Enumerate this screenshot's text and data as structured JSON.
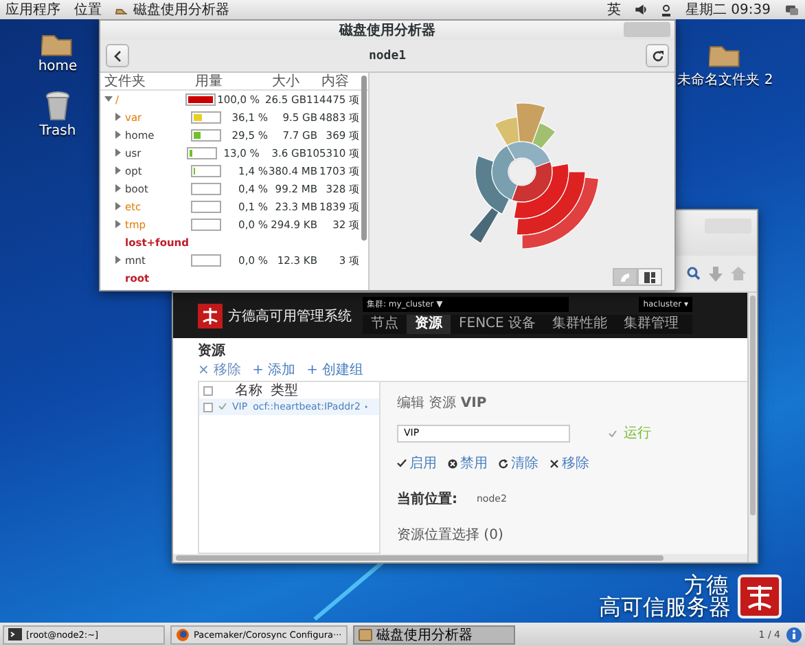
{
  "top_panel": {
    "menus": [
      "应用程序",
      "位置"
    ],
    "active_app": "磁盘使用分析器",
    "input_method": "英",
    "clock": "星期二 09:39"
  },
  "desktop_icons": [
    {
      "label": "home",
      "kind": "folder"
    },
    {
      "label": "Trash",
      "kind": "trash"
    },
    {
      "label": "未命名文件夹 2",
      "kind": "folder"
    }
  ],
  "wallpaper_text": [
    "方德",
    "高可信服务器"
  ],
  "disk_window": {
    "title": "磁盘使用分析器",
    "location": "node1",
    "columns": [
      "文件夹",
      "用量",
      "大小",
      "内容"
    ],
    "tree": [
      {
        "name": "/",
        "color": "#e07b00",
        "expanded": true,
        "level": 1,
        "percent": "100,0 %",
        "size": "26.5 GB",
        "count": "114475 项",
        "children": [
          {
            "name": "var",
            "color": "#e07b00",
            "expanded": false,
            "level": 0.361,
            "percent": "36,1 %",
            "size": "9.5 GB",
            "count": "4883 项"
          },
          {
            "name": "home",
            "color": "#3c3c3c",
            "expanded": false,
            "level": 0.295,
            "percent": "29,5 %",
            "size": "7.7 GB",
            "count": "369 项"
          },
          {
            "name": "usr",
            "color": "#3c3c3c",
            "expanded": false,
            "level": 0.13,
            "percent": "13,0 %",
            "size": "3.6 GB",
            "count": "105310 项"
          },
          {
            "name": "opt",
            "color": "#3c3c3c",
            "expanded": false,
            "level": 0.014,
            "percent": "1,4 %",
            "size": "380.4 MB",
            "count": "1703 项"
          },
          {
            "name": "boot",
            "color": "#3c3c3c",
            "expanded": false,
            "level": 0.004,
            "percent": "0,4 %",
            "size": "99.2 MB",
            "count": "328 项"
          },
          {
            "name": "etc",
            "color": "#e07b00",
            "expanded": false,
            "level": 0.001,
            "percent": "0,1 %",
            "size": "23.3 MB",
            "count": "1839 项"
          },
          {
            "name": "tmp",
            "color": "#e07b00",
            "expanded": false,
            "level": 0,
            "percent": "0,0 %",
            "size": "294.9 KB",
            "count": "32 项"
          },
          {
            "name": "lost+found",
            "color": "#c01c28"
          },
          {
            "name": "mnt",
            "color": "#3c3c3c",
            "expanded": false,
            "level": 0,
            "percent": "0,0 %",
            "size": "12.3 KB",
            "count": "3 项"
          },
          {
            "name": "root",
            "color": "#c01c28"
          }
        ]
      }
    ],
    "view_buttons": [
      {
        "kind": "rings",
        "selected": true
      },
      {
        "kind": "treemap",
        "selected": false
      }
    ]
  },
  "web_app": {
    "brand": "方德高可用管理系统",
    "cluster_select": "集群: my_cluster ▼",
    "user_menu": "hacluster ▾",
    "nav": [
      {
        "label": "节点",
        "selected": false
      },
      {
        "label": "资源",
        "selected": true
      },
      {
        "label": "FENCE 设备",
        "selected": false
      },
      {
        "label": "集群性能",
        "selected": false
      },
      {
        "label": "集群管理",
        "selected": false
      }
    ],
    "heading": "资源",
    "actions": [
      {
        "kind": "remove",
        "label": "× 移除"
      },
      {
        "kind": "add",
        "label": "+ 添加"
      },
      {
        "kind": "add",
        "label": "+ 创建组"
      }
    ],
    "header_checked": false,
    "columns": [
      "名称",
      "类型"
    ],
    "rows": [
      {
        "checked": false,
        "running": true,
        "name": "VIP",
        "type": "ocf::heartbeat:IPaddr2",
        "selected": true
      }
    ],
    "edit": {
      "title": "编辑 资源 **VIP**",
      "name_value": "VIP",
      "status": "运行",
      "actions": [
        {
          "kind": "enable",
          "label": "启用"
        },
        {
          "kind": "disable",
          "label": "禁用"
        },
        {
          "kind": "cleanup",
          "label": "清除"
        },
        {
          "kind": "remove",
          "label": "移除"
        }
      ],
      "location_label": "当前位置:",
      "location_value": "node2",
      "constraints": "资源位置选择 (0)"
    }
  },
  "taskbar": {
    "items": [
      {
        "kind": "terminal",
        "label": "[root@node2:~]",
        "selected": false
      },
      {
        "kind": "browser",
        "label": "Pacemaker/Corosync Configura···",
        "selected": false
      },
      {
        "kind": "disk",
        "label": "磁盘使用分析器",
        "selected": true
      }
    ],
    "workspace": "1 / 4"
  }
}
